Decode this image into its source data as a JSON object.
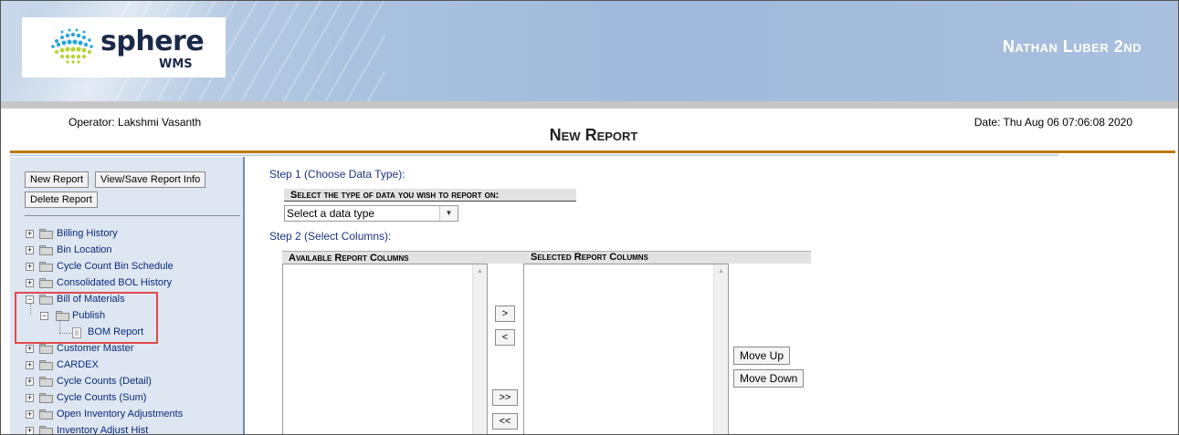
{
  "header": {
    "logo_text": "sphere",
    "logo_subtext": "WMS",
    "username": "Nathan Luber 2nd",
    "operator": "Operator: Lakshmi Vasanth",
    "date": "Date: Thu Aug 06 07:06:08 2020",
    "title": "New Report"
  },
  "sidebar": {
    "buttons": {
      "new_report": "New Report",
      "view_save": "View/Save Report Info",
      "delete_report": "Delete Report"
    },
    "tree": [
      {
        "label": "Billing History",
        "toggle": "+"
      },
      {
        "label": "Bin Location",
        "toggle": "+"
      },
      {
        "label": "Cycle Count Bin Schedule",
        "toggle": "+"
      },
      {
        "label": "Consolidated BOL History",
        "toggle": "+"
      },
      {
        "label": "Bill of Materials",
        "toggle": "−"
      },
      {
        "label": "Publish",
        "toggle": "−"
      },
      {
        "label": "BOM Report",
        "toggle": ""
      },
      {
        "label": "Customer Master",
        "toggle": "+"
      },
      {
        "label": "CARDEX",
        "toggle": "+"
      },
      {
        "label": "Cycle Counts (Detail)",
        "toggle": "+"
      },
      {
        "label": "Cycle Counts (Sum)",
        "toggle": "+"
      },
      {
        "label": "Open Inventory Adjustments",
        "toggle": "+"
      },
      {
        "label": "Inventory Adjust Hist",
        "toggle": "+"
      }
    ]
  },
  "main": {
    "step1": "Step 1 (Choose Data Type):",
    "step1_header": "Select the type of data you wish to report on:",
    "data_type_select": "Select a data type",
    "step2": "Step 2 (Select Columns):",
    "available_header": "Available Report Columns",
    "selected_header": "Selected Report Columns",
    "move_right": ">",
    "move_left": "<",
    "move_all_right": ">>",
    "move_all_left": "<<",
    "move_up": "Move Up",
    "move_down": "Move Down"
  }
}
